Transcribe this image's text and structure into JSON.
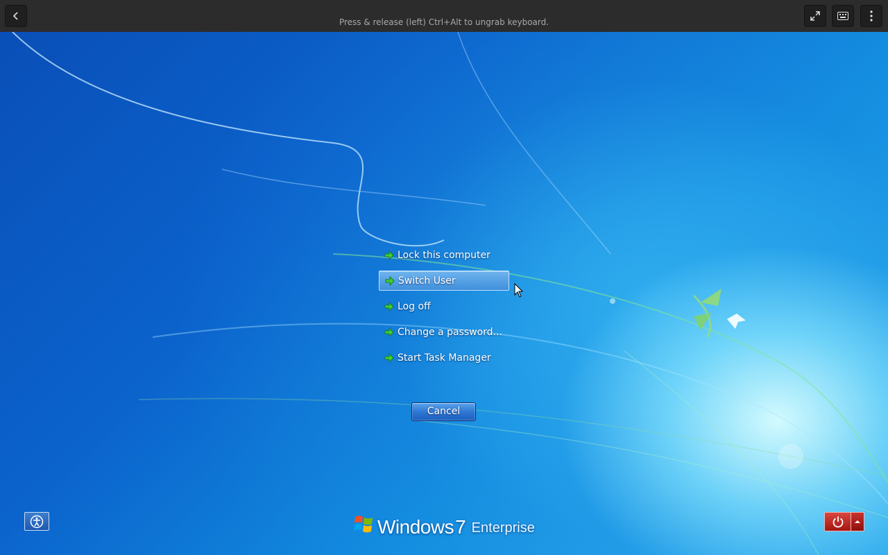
{
  "topbar": {
    "hint": "Press & release (left) Ctrl+Alt to ungrab keyboard.",
    "back_icon": "chevron-left-icon",
    "fullscreen_icon": "fullscreen-icon",
    "keyboard_icon": "keyboard-icon",
    "more_icon": "more-vertical-icon"
  },
  "menu": {
    "items": [
      {
        "label": "Lock this computer"
      },
      {
        "label": "Switch User",
        "selected": true
      },
      {
        "label": "Log off"
      },
      {
        "label": "Change a password..."
      },
      {
        "label": "Start Task Manager"
      }
    ],
    "cancel_label": "Cancel"
  },
  "branding": {
    "word": "Windows",
    "version": "7",
    "edition": "Enterprise"
  },
  "bottom": {
    "ease_of_access_icon": "ease-of-access-icon",
    "power_icon": "power-icon",
    "power_options_icon": "chevron-up-icon"
  },
  "colors": {
    "topbar": "#2c2c2c",
    "desktop_blue": "#0b63cc",
    "power_red": "#c0302a",
    "arrow_green": "#3fcf3a"
  }
}
